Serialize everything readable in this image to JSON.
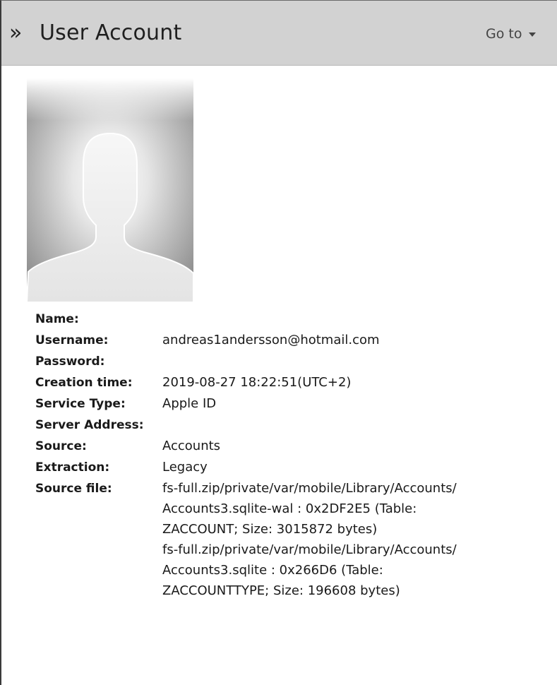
{
  "header": {
    "chevron": "»",
    "title": "User Account",
    "goto_label": "Go to"
  },
  "avatar": {
    "icon": "user-silhouette-icon"
  },
  "fields": {
    "name": {
      "label": "Name:",
      "value": ""
    },
    "username": {
      "label": "Username:",
      "value": "andreas1andersson@hotmail.com"
    },
    "password": {
      "label": "Password:",
      "value": ""
    },
    "creation_time": {
      "label": "Creation time:",
      "value": "2019-08-27 18:22:51(UTC+2)"
    },
    "service_type": {
      "label": "Service Type:",
      "value": "Apple ID"
    },
    "server_address": {
      "label": "Server Address:",
      "value": ""
    },
    "source": {
      "label": "Source:",
      "value": "Accounts"
    },
    "extraction": {
      "label": "Extraction:",
      "value": "Legacy"
    },
    "source_file": {
      "label": "Source file:",
      "lines": [
        "fs-full.zip/private/var/mobile/Library/Accounts/",
        "Accounts3.sqlite-wal : 0x2DF2E5 (Table:",
        "ZACCOUNT; Size: 3015872 bytes)",
        "fs-full.zip/private/var/mobile/Library/Accounts/",
        "Accounts3.sqlite : 0x266D6 (Table:",
        "ZACCOUNTTYPE; Size: 196608 bytes)"
      ]
    }
  }
}
